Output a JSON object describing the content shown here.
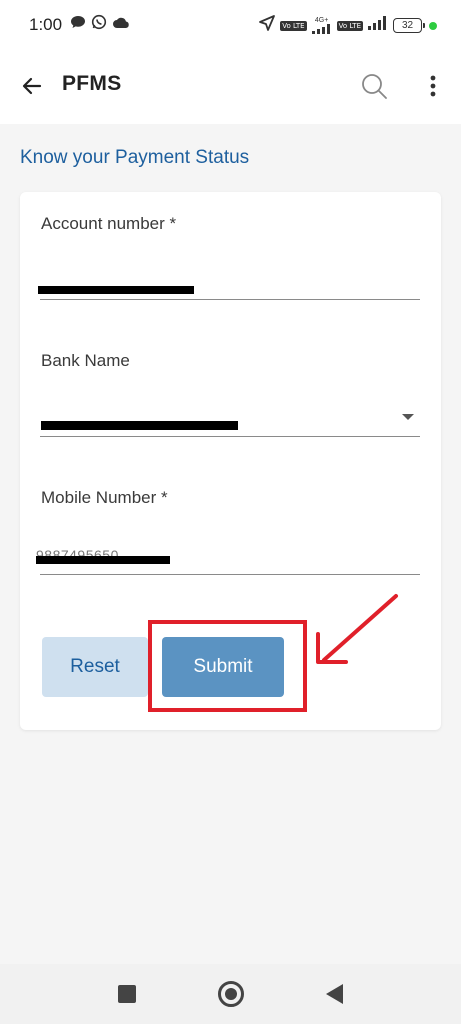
{
  "status_bar": {
    "time": "1:00",
    "network_type": "4G+",
    "volte_badge": "Vo LTE",
    "battery_level": "32",
    "icons": [
      "chat-bubble-icon",
      "whatsapp-icon",
      "cloud-icon",
      "location-arrow-icon",
      "signal-icon",
      "signal-icon",
      "battery-icon",
      "green-dot-indicator"
    ]
  },
  "app_bar": {
    "title": "PFMS",
    "icons": [
      "back-arrow-icon",
      "search-icon",
      "more-vert-icon"
    ]
  },
  "main": {
    "section_title": "Know your Payment Status",
    "form": {
      "fields": [
        {
          "label": "Account number *",
          "value": ""
        },
        {
          "label": "Bank Name",
          "value": ""
        },
        {
          "label": "Mobile Number *",
          "value": "9887495650"
        }
      ],
      "reset_label": "Reset",
      "submit_label": "Submit"
    }
  },
  "annotation_color": "#e0202a",
  "accent_color": "#1d5f9e",
  "nav_bar": {
    "icons": [
      "recents-square-icon",
      "home-circle-icon",
      "back-triangle-icon"
    ]
  }
}
